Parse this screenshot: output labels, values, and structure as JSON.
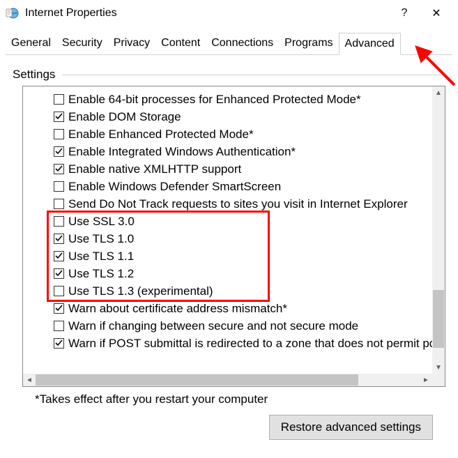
{
  "window": {
    "title": "Internet Properties",
    "help_symbol": "?",
    "close_symbol": "✕"
  },
  "tabs": {
    "items": [
      {
        "label": "General"
      },
      {
        "label": "Security"
      },
      {
        "label": "Privacy"
      },
      {
        "label": "Content"
      },
      {
        "label": "Connections"
      },
      {
        "label": "Programs"
      },
      {
        "label": "Advanced"
      }
    ],
    "active_index": 6
  },
  "group": {
    "title": "Settings"
  },
  "settings": [
    {
      "checked": false,
      "label": "Enable 64-bit processes for Enhanced Protected Mode*"
    },
    {
      "checked": true,
      "label": "Enable DOM Storage"
    },
    {
      "checked": false,
      "label": "Enable Enhanced Protected Mode*"
    },
    {
      "checked": true,
      "label": "Enable Integrated Windows Authentication*"
    },
    {
      "checked": true,
      "label": "Enable native XMLHTTP support"
    },
    {
      "checked": false,
      "label": "Enable Windows Defender SmartScreen"
    },
    {
      "checked": false,
      "label": "Send Do Not Track requests to sites you visit in Internet Explorer"
    },
    {
      "checked": false,
      "label": "Use SSL 3.0"
    },
    {
      "checked": true,
      "label": "Use TLS 1.0"
    },
    {
      "checked": true,
      "label": "Use TLS 1.1"
    },
    {
      "checked": true,
      "label": "Use TLS 1.2"
    },
    {
      "checked": false,
      "label": "Use TLS 1.3 (experimental)"
    },
    {
      "checked": true,
      "label": "Warn about certificate address mismatch*"
    },
    {
      "checked": false,
      "label": "Warn if changing between secure and not secure mode"
    },
    {
      "checked": true,
      "label": "Warn if POST submittal is redirected to a zone that does not permit posts"
    }
  ],
  "highlight": {
    "start_index": 7,
    "end_index": 11
  },
  "footer": {
    "note": "*Takes effect after you restart your computer",
    "restore_label": "Restore advanced settings"
  },
  "scroll": {
    "v_thumb_top_pct": 73,
    "v_thumb_height_pct": 22,
    "h_thumb_left_pct": 0,
    "h_thumb_width_pct": 84
  }
}
